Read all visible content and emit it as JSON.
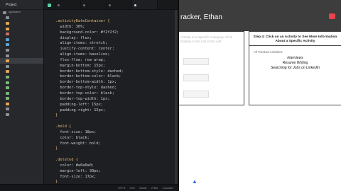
{
  "sidebar": {
    "title": "Project",
    "items": [
      {
        "label": "application",
        "color": "#8e9297",
        "selected": false
      },
      {
        "label": "",
        "color": "#8e9297",
        "selected": false
      },
      {
        "label": "",
        "color": "#e5a454",
        "selected": false
      },
      {
        "label": "",
        "color": "#e5a454",
        "selected": false
      },
      {
        "label": "",
        "color": "#d36a6a",
        "selected": false
      },
      {
        "label": "",
        "color": "#5fa3d6",
        "selected": false
      },
      {
        "label": "",
        "color": "#5fa3d6",
        "selected": false
      },
      {
        "label": "",
        "color": "#8e9297",
        "selected": false
      },
      {
        "label": "",
        "color": "#8e9297",
        "selected": false
      },
      {
        "label": "",
        "color": "#e5a454",
        "selected": true
      },
      {
        "label": "",
        "color": "#8e9297",
        "selected": false
      },
      {
        "label": "",
        "color": "#e5a454",
        "selected": false
      },
      {
        "label": "",
        "color": "#7bb87b",
        "selected": false
      },
      {
        "label": "",
        "color": "#7bb87b",
        "selected": false
      },
      {
        "label": "",
        "color": "#7bb87b",
        "selected": false
      },
      {
        "label": "",
        "color": "#7bb87b",
        "selected": false
      },
      {
        "label": "",
        "color": "#7bb87b",
        "selected": false
      },
      {
        "label": "",
        "color": "#e5a454",
        "selected": false
      },
      {
        "label": "",
        "color": "#8e9297",
        "selected": false
      },
      {
        "label": "",
        "color": "#8e9297",
        "selected": false
      }
    ]
  },
  "tabs": [
    {
      "label": "",
      "active": false
    },
    {
      "label": "",
      "active": false
    },
    {
      "label": "",
      "active": false
    },
    {
      "label": "",
      "active": true
    }
  ],
  "editor": {
    "lines": [
      {
        "text": ".activityDateContainer {",
        "kind": "sel"
      },
      {
        "text": "  width: 30%;",
        "kind": "prop"
      },
      {
        "text": "  background-color: #f2f2f2;",
        "kind": "prop"
      },
      {
        "text": "  display: flex;",
        "kind": "prop"
      },
      {
        "text": "  align-items: stretch;",
        "kind": "prop"
      },
      {
        "text": "  justify-content: center;",
        "kind": "prop"
      },
      {
        "text": "  align-items: baseline;",
        "kind": "prop"
      },
      {
        "text": "  flex-flow: row wrap;",
        "kind": "prop"
      },
      {
        "text": "  margin-bottom: 15px;",
        "kind": "prop"
      },
      {
        "text": "  border-bottom-style: dashed;",
        "kind": "prop"
      },
      {
        "text": "  border-bottom-color: black;",
        "kind": "prop"
      },
      {
        "text": "  border-bottom-width: 1px;",
        "kind": "prop"
      },
      {
        "text": "  border-top-style: dashed;",
        "kind": "prop"
      },
      {
        "text": "  border-top-color: black;",
        "kind": "prop"
      },
      {
        "text": "  border-top-width: 1px;",
        "kind": "prop"
      },
      {
        "text": "  padding-left: 15px;",
        "kind": "prop"
      },
      {
        "text": "  padding-right: 15px;",
        "kind": "prop"
      },
      {
        "text": "}",
        "kind": "sel"
      },
      {
        "text": "",
        "kind": "prop"
      },
      {
        "text": ".bold {",
        "kind": "sel"
      },
      {
        "text": "  font-size: 18px;",
        "kind": "prop"
      },
      {
        "text": "  color: black;",
        "kind": "prop"
      },
      {
        "text": "  font-weight: bold;",
        "kind": "prop"
      },
      {
        "text": "}",
        "kind": "sel"
      },
      {
        "text": "",
        "kind": "prop"
      },
      {
        "text": ".deleted {",
        "kind": "sel"
      },
      {
        "text": "  color: #a0a0a0;",
        "kind": "prop"
      },
      {
        "text": "  margin-left: 30px;",
        "kind": "prop"
      },
      {
        "text": "  font-size: 17px;",
        "kind": "prop"
      },
      {
        "text": "}",
        "kind": "sel"
      }
    ]
  },
  "status": {
    "left": "",
    "encoding": "UTF-8",
    "language": "CSS",
    "git": "master",
    "files": "2 files",
    "updates": "3 updates"
  },
  "browser": {
    "title": "racker, Ethan",
    "left_panel": {
      "header": "Activity to a Specific Category. Click Display in the List to the Left",
      "buttons": [
        "",
        "",
        ""
      ]
    },
    "right_panel": {
      "header": "Step 4: Click on an Activity to See More Information About a Specific Activity",
      "label": "All Tracked Activities:",
      "activities": [
        "Interviews",
        "Resume Writing",
        "Searching for Jobs on LinkedIn"
      ]
    }
  }
}
